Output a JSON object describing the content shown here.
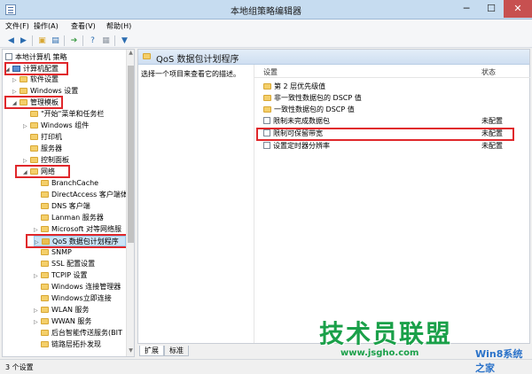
{
  "window": {
    "title": "本地组策略编辑器"
  },
  "menu": [
    "文件(F)",
    "操作(A)",
    "查看(V)",
    "帮助(H)"
  ],
  "toolbar": {
    "buttons": [
      "back-icon",
      "forward-icon",
      "folder-up-icon",
      "show-hide-tree-icon",
      "export-list-icon",
      "help-icon",
      "properties-icon",
      "filter-icon"
    ]
  },
  "tree": {
    "root": "本地计算机 策略",
    "items": [
      {
        "label": "计算机配置"
      },
      {
        "label": "软件设置"
      },
      {
        "label": "Windows 设置"
      },
      {
        "label": "管理模板"
      },
      {
        "label": "\"开始\"菜单和任务栏"
      },
      {
        "label": "Windows 组件"
      },
      {
        "label": "打印机"
      },
      {
        "label": "服务器"
      },
      {
        "label": "控制面板"
      },
      {
        "label": "网络"
      },
      {
        "label": "BranchCache"
      },
      {
        "label": "DirectAccess 客户端体"
      },
      {
        "label": "DNS 客户端"
      },
      {
        "label": "Lanman 服务器"
      },
      {
        "label": "Microsoft 对等网络服"
      },
      {
        "label": "QoS 数据包计划程序"
      },
      {
        "label": "SNMP"
      },
      {
        "label": "SSL 配置设置"
      },
      {
        "label": "TCPIP 设置"
      },
      {
        "label": "Windows 连接管理器"
      },
      {
        "label": "Windows立即连接"
      },
      {
        "label": "WLAN 服务"
      },
      {
        "label": "WWAN 服务"
      },
      {
        "label": "后台智能传送服务(BIT"
      },
      {
        "label": "链路层拓扑发现"
      }
    ]
  },
  "main": {
    "header": "QoS 数据包计划程序",
    "description": "选择一个项目来查看它的描述。",
    "columns": {
      "setting": "设置",
      "state": "状态"
    },
    "rows": [
      {
        "name": "第 2 层优先级值",
        "state": "",
        "icon": "folder"
      },
      {
        "name": "非一致性数据包的 DSCP 值",
        "state": "",
        "icon": "folder"
      },
      {
        "name": "一致性数据包的 DSCP 值",
        "state": "",
        "icon": "folder"
      },
      {
        "name": "限制未完成数据包",
        "state": "未配置",
        "icon": "setting"
      },
      {
        "name": "限制可保留带宽",
        "state": "未配置",
        "icon": "setting"
      },
      {
        "name": "设置定时器分辨率",
        "state": "未配置",
        "icon": "setting"
      }
    ]
  },
  "tabs": [
    "扩展",
    "标准"
  ],
  "status": "3 个设置",
  "watermark": {
    "text": "技术员联盟",
    "url": "www.jsgho.com",
    "tail": "Win8系统之家"
  },
  "colors": {
    "highlight_box": "#e0272b",
    "selection": "#cce4f7",
    "watermark": "#1aa049"
  }
}
